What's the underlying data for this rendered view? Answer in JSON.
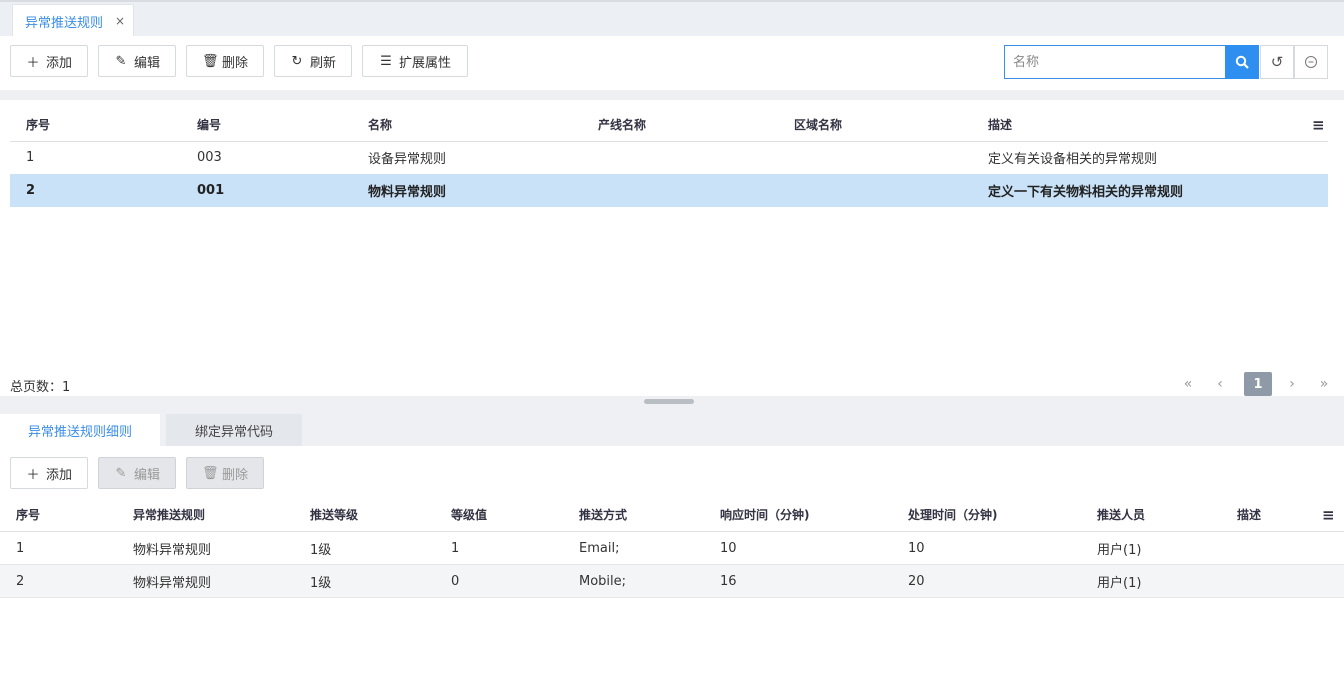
{
  "window_tab": {
    "title": "异常推送规则",
    "close": "×"
  },
  "toolbar": {
    "add": "添加",
    "edit": "编辑",
    "delete": "删除",
    "refresh": "刷新",
    "ext": "扩展属性"
  },
  "search": {
    "placeholder": "名称",
    "value": ""
  },
  "main_table": {
    "columns": [
      "序号",
      "编号",
      "名称",
      "产线名称",
      "区域名称",
      "描述"
    ],
    "rows": [
      {
        "seq": "1",
        "code": "003",
        "name": "设备异常规则",
        "line": "",
        "area": "",
        "desc": "定义有关设备相关的异常规则"
      },
      {
        "seq": "2",
        "code": "001",
        "name": "物料异常规则",
        "line": "",
        "area": "",
        "desc": "定义一下有关物料相关的异常规则"
      }
    ],
    "selected_row": 2
  },
  "pager": {
    "total_label": "总页数：1",
    "first": "«",
    "prev": "‹",
    "current": "1",
    "next": "›",
    "last": "»"
  },
  "subtabs": {
    "detail": "异常推送规则细则",
    "bind": "绑定异常代码"
  },
  "sub_toolbar": {
    "add": "添加",
    "edit": "编辑",
    "delete": "删除"
  },
  "detail_table": {
    "columns": [
      "序号",
      "异常推送规则",
      "推送等级",
      "等级值",
      "推送方式",
      "响应时间（分钟)",
      "处理时间（分钟)",
      "推送人员",
      "描述"
    ],
    "rows": [
      {
        "seq": "1",
        "rule": "物料异常规则",
        "level": "1级",
        "level_value": "1",
        "method": "Email;",
        "response": "10",
        "handle": "10",
        "person": "用户(1)",
        "desc": ""
      },
      {
        "seq": "2",
        "rule": "物料异常规则",
        "level": "1级",
        "level_value": "0",
        "method": "Mobile;",
        "response": "16",
        "handle": "20",
        "person": "用户(1)",
        "desc": ""
      }
    ]
  },
  "colors": {
    "accent": "#2f8ff0",
    "selected_row": "#c9e2f8",
    "tab_text": "#3a8ee6"
  },
  "icons": {
    "add": "plus-icon",
    "edit": "edit-icon",
    "delete": "trash-icon",
    "refresh": "refresh-icon",
    "ext": "list-icon",
    "search": "search-icon",
    "reset": "reset-icon",
    "more": "more-icon",
    "columns": "menu-icon"
  }
}
